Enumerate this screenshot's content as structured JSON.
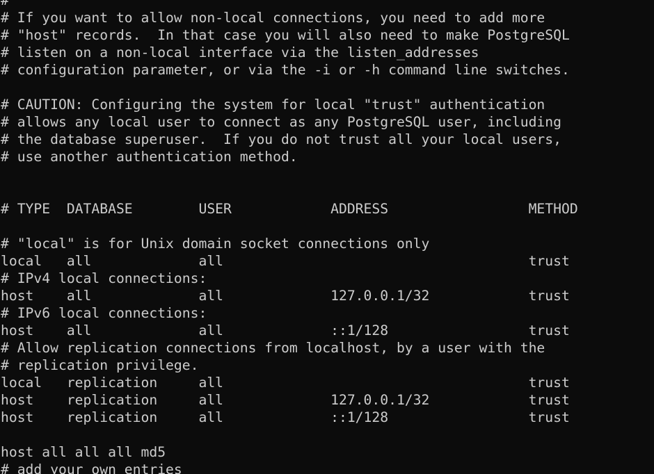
{
  "terminal": {
    "foreground": "#cccccc",
    "background": "#0c0c0c",
    "lines": [
      "#",
      "# If you want to allow non-local connections, you need to add more",
      "# \"host\" records.  In that case you will also need to make PostgreSQL",
      "# listen on a non-local interface via the listen_addresses",
      "# configuration parameter, or via the -i or -h command line switches.",
      "",
      "# CAUTION: Configuring the system for local \"trust\" authentication",
      "# allows any local user to connect as any PostgreSQL user, including",
      "# the database superuser.  If you do not trust all your local users,",
      "# use another authentication method.",
      "",
      "",
      "# TYPE  DATABASE        USER            ADDRESS                 METHOD",
      "",
      "# \"local\" is for Unix domain socket connections only",
      "local   all             all                                     trust",
      "# IPv4 local connections:",
      "host    all             all             127.0.0.1/32            trust",
      "# IPv6 local connections:",
      "host    all             all             ::1/128                 trust",
      "# Allow replication connections from localhost, by a user with the",
      "# replication privilege.",
      "local   replication     all                                     trust",
      "host    replication     all             127.0.0.1/32            trust",
      "host    replication     all             ::1/128                 trust",
      "",
      "host all all all md5",
      "# add your own entries"
    ]
  }
}
